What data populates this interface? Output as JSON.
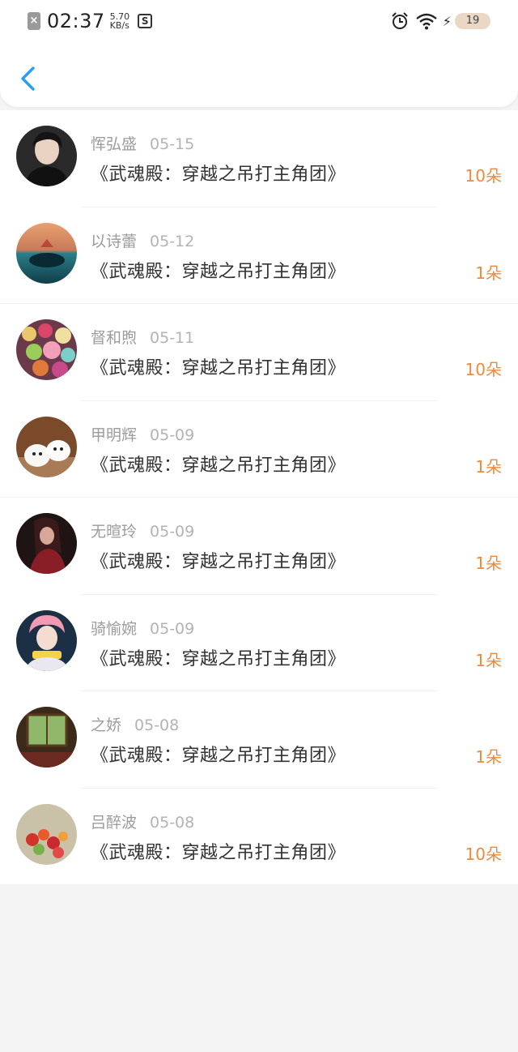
{
  "status_bar": {
    "time": "02:37",
    "speed_value": "5.70",
    "speed_unit": "KB/s",
    "battery": "19",
    "icons": [
      "sim-off-icon",
      "s-app-icon",
      "alarm-icon",
      "wifi-icon",
      "charging-icon",
      "battery-icon"
    ]
  },
  "nav": {
    "back_icon": "chevron-left-icon",
    "accent": "#2a9df4"
  },
  "colors": {
    "amount": "#ef8a3c",
    "name": "#9c9c9c"
  },
  "items": [
    {
      "name": "恽弘盛",
      "date": "05-15",
      "title": "《武魂殿：穿越之吊打主角团》",
      "amount": "10朵"
    },
    {
      "name": "以诗蕾",
      "date": "05-12",
      "title": "《武魂殿：穿越之吊打主角团》",
      "amount": "1朵"
    },
    {
      "name": "督和煦",
      "date": "05-11",
      "title": "《武魂殿：穿越之吊打主角团》",
      "amount": "10朵"
    },
    {
      "name": "甲明辉",
      "date": "05-09",
      "title": "《武魂殿：穿越之吊打主角团》",
      "amount": "1朵"
    },
    {
      "name": "无暄玲",
      "date": "05-09",
      "title": "《武魂殿：穿越之吊打主角团》",
      "amount": "1朵"
    },
    {
      "name": "骑愉婉",
      "date": "05-09",
      "title": "《武魂殿：穿越之吊打主角团》",
      "amount": "1朵"
    },
    {
      "name": "之娇",
      "date": "05-08",
      "title": "《武魂殿：穿越之吊打主角团》",
      "amount": "1朵"
    },
    {
      "name": "吕醉波",
      "date": "05-08",
      "title": "《武魂殿：穿越之吊打主角团》",
      "amount": "10朵"
    }
  ]
}
